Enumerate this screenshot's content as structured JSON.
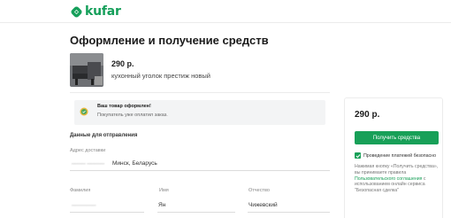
{
  "brand": {
    "logo_text": "kufar",
    "color": "#159f5a"
  },
  "page": {
    "title": "Оформление и получение средств"
  },
  "product": {
    "price": "290 р.",
    "name": "кухонный уголок престиж новый"
  },
  "notice": {
    "title": "Ваш товар оформлен!",
    "subtitle": "Покупатель уже оплатил заказ."
  },
  "shipping": {
    "section_title": "Данные для отправления",
    "address_label": "Адрес доставки",
    "address_value": "Минск, Беларусь",
    "fields": [
      {
        "label": "Фамилия",
        "value": ""
      },
      {
        "label": "Имя",
        "value": "Ян"
      },
      {
        "label": "Отчество",
        "value": "Чижевский"
      }
    ]
  },
  "sidebar": {
    "price": "290 р.",
    "button_label": "Получить средства",
    "safe_label": "Проведение платежей безопасно",
    "terms_before": "Нажимая кнопку «Получить средства», вы принимаете правила",
    "terms_link": "Пользовательского соглашения",
    "terms_after": "с использованием онлайн сервиса \"Безопасная сделка\"",
    "accent_color": "#18a058"
  }
}
